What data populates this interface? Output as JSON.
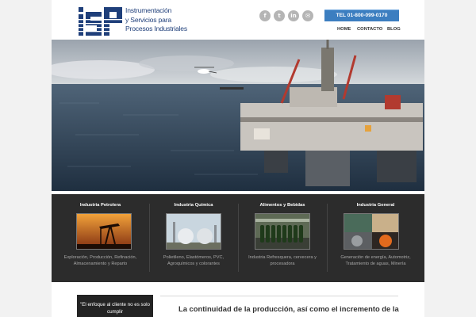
{
  "brand": {
    "logo_lines": [
      "Instrumentación",
      "y Servicios para",
      "Procesos Industriales"
    ],
    "logo_initials": "iSPI",
    "color": "#1f3f7a"
  },
  "header": {
    "social": [
      {
        "icon": "facebook-icon",
        "glyph": "f"
      },
      {
        "icon": "twitter-icon",
        "glyph": "t"
      },
      {
        "icon": "linkedin-icon",
        "glyph": "in"
      },
      {
        "icon": "email-icon",
        "glyph": "✉"
      }
    ],
    "phone_label": "TEL 01-800-099-0170",
    "nav": [
      "HOME",
      "CONTACTO",
      "BLOG"
    ]
  },
  "industries": [
    {
      "title": "Industria Petrolera",
      "description": "Exploración, Producción, Refinación, Almacenamiento y Reparto"
    },
    {
      "title": "Industria Química",
      "description": "Polietileno, Elastómeros, PVC, Agroquímicos y colorantes"
    },
    {
      "title": "Alimentos y Bebidas",
      "description": "Industria Refresquera, cervecera y procesadora"
    },
    {
      "title": "Industria General",
      "description": "Generación de energía, Automotriz, Tratamiento de aguas, Minería"
    }
  ],
  "quote": {
    "text": "\"El enfoque al cliente no es solo cumplir"
  },
  "content": {
    "heading": "La continuidad de la producción, así como el incremento de la"
  },
  "colors": {
    "accent": "#3c7ec0",
    "band": "#2c2c2c"
  }
}
